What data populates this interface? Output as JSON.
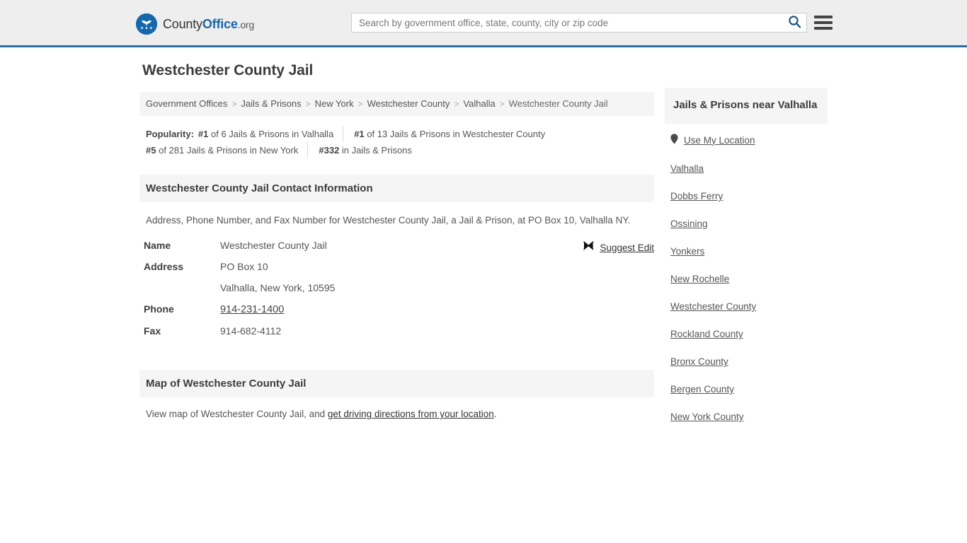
{
  "header": {
    "brand": {
      "part1": "County",
      "part2": "Office",
      "part3": ".org",
      "logo_icon": "eagle-shield-logo"
    },
    "search": {
      "placeholder": "Search by government office, state, county, city or zip code",
      "value": "",
      "search_icon": "search-icon"
    },
    "menu_icon": "hamburger-menu-icon",
    "accent_color": "#1767ad",
    "border_color": "#2e6da4",
    "background": "#eeeeee"
  },
  "page": {
    "title": "Westchester County Jail"
  },
  "breadcrumb": {
    "separator": ">",
    "items": [
      {
        "label": "Government Offices"
      },
      {
        "label": "Jails & Prisons"
      },
      {
        "label": "New York"
      },
      {
        "label": "Westchester County"
      },
      {
        "label": "Valhalla"
      },
      {
        "label": "Westchester County Jail"
      }
    ]
  },
  "popularity": {
    "label": "Popularity:",
    "items": [
      {
        "rank": "#1",
        "text": "of 6 Jails & Prisons in Valhalla"
      },
      {
        "rank": "#1",
        "text": "of 13 Jails & Prisons in Westchester County"
      },
      {
        "rank": "#5",
        "text": "of 281 Jails & Prisons in New York"
      },
      {
        "rank": "#332",
        "text": "in Jails & Prisons"
      }
    ]
  },
  "contact": {
    "section_title": "Westchester County Jail Contact Information",
    "description": "Address, Phone Number, and Fax Number for Westchester County Jail, a Jail & Prison, at PO Box 10, Valhalla NY.",
    "rows": [
      {
        "key": "Name",
        "value": "Westchester County Jail"
      },
      {
        "key": "Address",
        "value": "PO Box 10"
      },
      {
        "key": "",
        "value": "Valhalla, New York, 10595"
      },
      {
        "key": "Phone",
        "value": "914-231-1400"
      },
      {
        "key": "Fax",
        "value": "914-682-4112"
      }
    ],
    "suggest_edit": {
      "label": "Suggest Edit",
      "icon": "pencil-edit-icon"
    }
  },
  "map": {
    "section_title": "Map of Westchester County Jail",
    "desc_before": "View map of Westchester County Jail, and ",
    "link_text": "get driving directions from your location",
    "desc_after": "."
  },
  "sidebar": {
    "title": "Jails & Prisons near Valhalla",
    "use_my_location": {
      "label": "Use My Location",
      "icon": "map-pin-icon"
    },
    "items": [
      {
        "label": "Valhalla"
      },
      {
        "label": "Dobbs Ferry"
      },
      {
        "label": "Ossining"
      },
      {
        "label": "Yonkers"
      },
      {
        "label": "New Rochelle"
      },
      {
        "label": "Westchester County"
      },
      {
        "label": "Rockland County"
      },
      {
        "label": "Bronx County"
      },
      {
        "label": "Bergen County"
      },
      {
        "label": "New York County"
      }
    ]
  }
}
